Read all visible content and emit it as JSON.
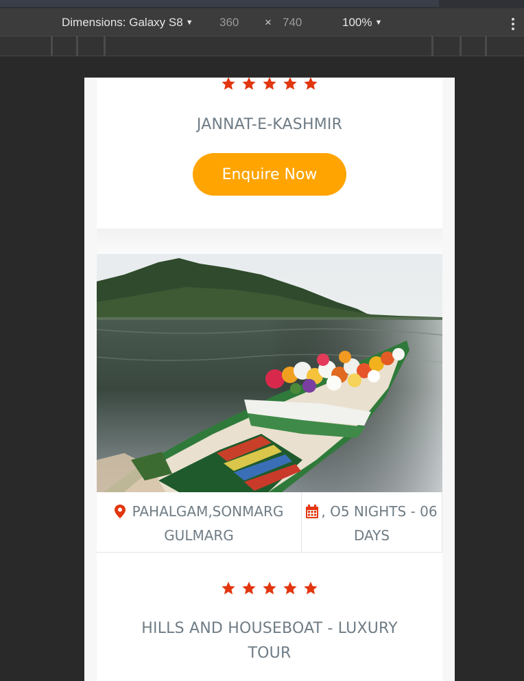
{
  "devtools": {
    "dimensions_label": "Dimensions: Galaxy S8",
    "width": "360",
    "times": "×",
    "height": "740",
    "zoom": "100%"
  },
  "colors": {
    "star": "#e2360f",
    "button": "#ffa400",
    "text": "#6f7c85",
    "icon": "#e2360f"
  },
  "card1": {
    "rating": 5,
    "title": "JANNAT-E-KASHMIR",
    "button_label": "Enquire Now"
  },
  "card2": {
    "image_alt": "flower-boat-on-lake-photo",
    "location_icon": "map-marker-icon",
    "location_line1": "PAHALGAM,SONMARG",
    "location_line2": "GULMARG",
    "duration_icon": "calendar-icon",
    "duration_line1": ", O5 NIGHTS - 06",
    "duration_line2": "DAYS",
    "rating": 5,
    "title_line1": "HILLS AND HOUSEBOAT - LUXURY",
    "title_line2": "TOUR"
  }
}
